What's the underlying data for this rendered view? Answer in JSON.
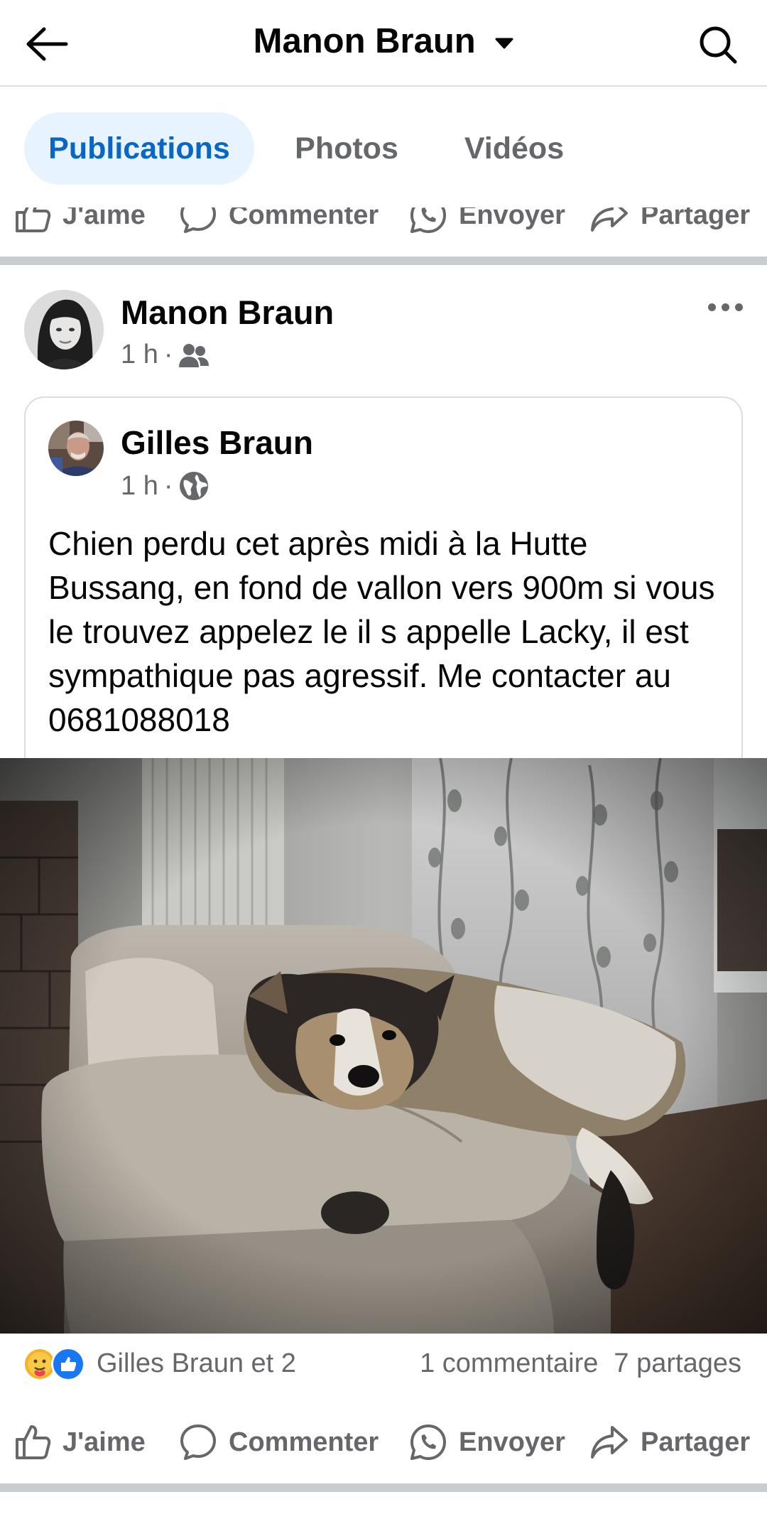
{
  "header": {
    "title": "Manon Braun"
  },
  "tabs": [
    {
      "label": "Publications",
      "active": true
    },
    {
      "label": "Photos",
      "active": false
    },
    {
      "label": "Vidéos",
      "active": false
    }
  ],
  "actions": {
    "like": "J'aime",
    "comment": "Commenter",
    "send": "Envoyer",
    "share": "Partager"
  },
  "post": {
    "author": "Manon Braun",
    "time": "1 h",
    "audience_icon": "friends-icon",
    "shared": {
      "author": "Gilles Braun",
      "time": "1 h",
      "audience_icon": "globe-icon",
      "text": "Chien perdu cet après midi à la Hutte Bussang, en fond de vallon vers 900m si vous le trouvez appelez le il s appelle Lacky, il est sympathique pas agressif. Me contacter au 0681088018"
    },
    "reactions": {
      "icons": [
        "care-reaction-icon",
        "like-reaction-icon"
      ],
      "text": "Gilles Braun et 2",
      "comments": "1 commentaire",
      "shares": "7 partages"
    }
  },
  "colors": {
    "accent": "#0866c6",
    "tab_active_bg": "#e7f3ff",
    "secondary_text": "#65676b",
    "separator": "#c9ccd1"
  }
}
